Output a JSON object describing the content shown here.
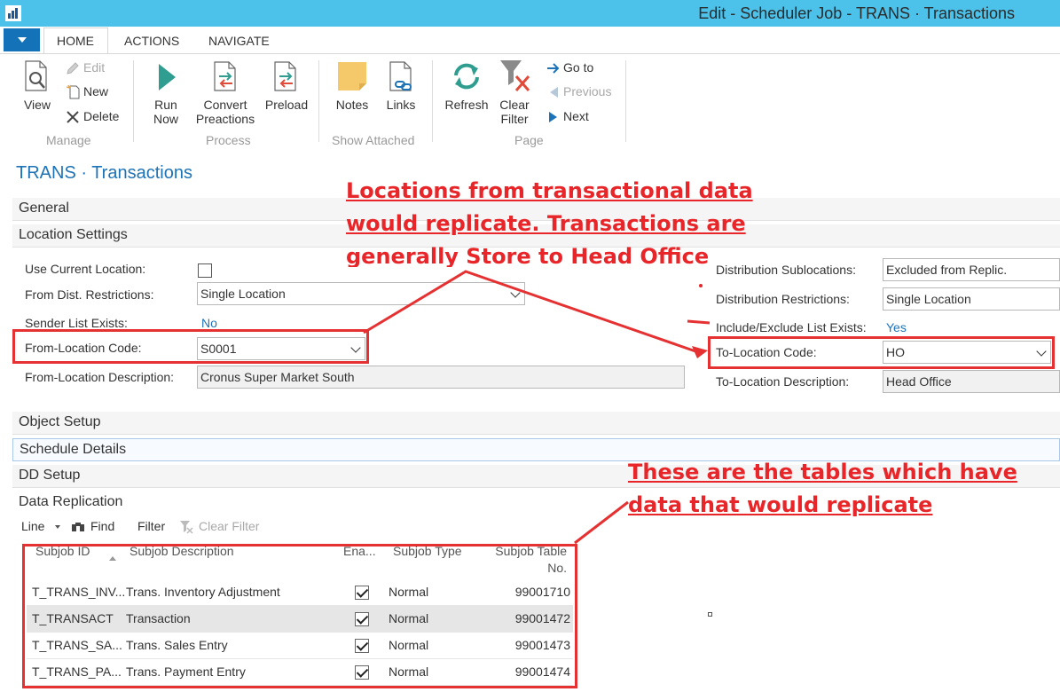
{
  "window": {
    "title": "Edit - Scheduler Job - TRANS · Transactions"
  },
  "ribbon_tabs": [
    "HOME",
    "ACTIONS",
    "NAVIGATE"
  ],
  "ribbon": {
    "manage": {
      "label": "Manage",
      "view": "View",
      "edit": "Edit",
      "new": "New",
      "delete": "Delete"
    },
    "process": {
      "label": "Process",
      "run_now_1": "Run",
      "run_now_2": "Now",
      "convert_1": "Convert",
      "convert_2": "Preactions",
      "preload": "Preload"
    },
    "show_attached": {
      "label": "Show Attached",
      "notes": "Notes",
      "links": "Links"
    },
    "page": {
      "label": "Page",
      "refresh": "Refresh",
      "clear_filter_1": "Clear",
      "clear_filter_2": "Filter",
      "go_to": "Go to",
      "previous": "Previous",
      "next": "Next"
    }
  },
  "page_title": "TRANS · Transactions",
  "fasttabs": {
    "general": "General",
    "location_settings": "Location Settings",
    "object_setup": "Object Setup",
    "schedule_details": "Schedule Details",
    "dd_setup": "DD Setup",
    "data_replication": "Data Replication"
  },
  "left_fields": {
    "use_current_location": {
      "label": "Use Current Location:"
    },
    "from_dist_restrictions": {
      "label": "From Dist. Restrictions:",
      "value": "Single Location"
    },
    "sender_list_exists": {
      "label": "Sender List Exists:",
      "value": "No"
    },
    "from_location_code": {
      "label": "From-Location Code:",
      "value": "S0001"
    },
    "from_location_description": {
      "label": "From-Location Description:",
      "value": "Cronus Super Market South"
    }
  },
  "right_fields": {
    "distribution_sublocations": {
      "label": "Distribution Sublocations:",
      "value": "Excluded from Replic."
    },
    "distribution_restrictions": {
      "label": "Distribution Restrictions:",
      "value": "Single Location"
    },
    "include_exclude_list_exists": {
      "label": "Include/Exclude List Exists:",
      "value": "Yes"
    },
    "to_location_code": {
      "label": "To-Location Code:",
      "value": "HO"
    },
    "to_location_description": {
      "label": "To-Location Description:",
      "value": "Head Office"
    }
  },
  "annotations": {
    "top": [
      "Locations from transactional data",
      "would replicate. Transactions are",
      "generally Store to Head Office"
    ],
    "bottom": [
      "These are the tables which have",
      "data that would replicate"
    ]
  },
  "list_toolbar": {
    "line": "Line",
    "find": "Find",
    "filter": "Filter",
    "clear_filter": "Clear Filter"
  },
  "table": {
    "headers": {
      "subjob_id": "Subjob ID",
      "subjob_description": "Subjob Description",
      "enabled": "Ena...",
      "subjob_type": "Subjob Type",
      "subjob_table_no_1": "Subjob Table",
      "subjob_table_no_2": "No."
    },
    "rows": [
      {
        "id": "T_TRANS_INV...",
        "description": "Trans. Inventory Adjustment",
        "type": "Normal",
        "table_no": "99001710"
      },
      {
        "id": "T_TRANSACT",
        "description": "Transaction",
        "type": "Normal",
        "table_no": "99001472"
      },
      {
        "id": "T_TRANS_SA...",
        "description": "Trans. Sales Entry",
        "type": "Normal",
        "table_no": "99001473"
      },
      {
        "id": "T_TRANS_PA...",
        "description": "Trans. Payment Entry",
        "type": "Normal",
        "table_no": "99001474"
      }
    ]
  },
  "colors": {
    "titlebar": "#4cc1e9",
    "accent": "#1e73b6",
    "annotation": "#e8262a"
  }
}
